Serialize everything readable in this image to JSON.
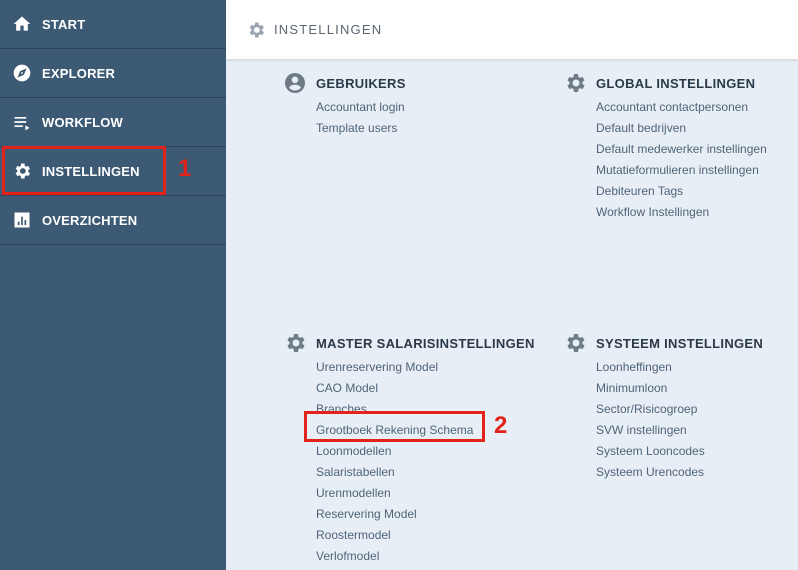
{
  "sidebar": {
    "items": [
      {
        "label": "START",
        "icon": "home-icon"
      },
      {
        "label": "EXPLORER",
        "icon": "compass-icon"
      },
      {
        "label": "WORKFLOW",
        "icon": "list-icon"
      },
      {
        "label": "INSTELLINGEN",
        "icon": "gear-icon"
      },
      {
        "label": "OVERZICHTEN",
        "icon": "chart-icon"
      }
    ]
  },
  "header": {
    "title": "INSTELLINGEN",
    "icon": "gear-icon"
  },
  "sections": {
    "gebruikers": {
      "title": "GEBRUIKERS",
      "icon": "user-icon",
      "links": [
        "Accountant login",
        "Template users"
      ]
    },
    "global": {
      "title": "GLOBAL INSTELLINGEN",
      "icon": "gear-icon",
      "links": [
        "Accountant contactpersonen",
        "Default bedrijven",
        "Default medewerker instellingen",
        "Mutatieformulieren instellingen",
        "Debiteuren Tags",
        "Workflow Instellingen"
      ]
    },
    "master": {
      "title": "MASTER SALARISINSTELLINGEN",
      "icon": "gear-icon",
      "links": [
        "Urenreservering Model",
        "CAO Model",
        "Branches",
        "Grootboek Rekening Schema",
        "Loonmodellen",
        "Salaristabellen",
        "Urenmodellen",
        "Reservering Model",
        "Roostermodel",
        "Verlofmodel"
      ]
    },
    "systeem": {
      "title": "SYSTEEM INSTELLINGEN",
      "icon": "gear-icon",
      "links": [
        "Loonheffingen",
        "Minimumloon",
        "Sector/Risicogroep",
        "SVW instellingen",
        "Systeem Looncodes",
        "Systeem Urencodes"
      ]
    }
  },
  "annotations": {
    "marker1": "1",
    "marker2": "2"
  },
  "colors": {
    "sidebar": "#3d5a75",
    "highlight": "#e2231a",
    "content_bg": "#e8eef5",
    "link": "#4f6478"
  }
}
